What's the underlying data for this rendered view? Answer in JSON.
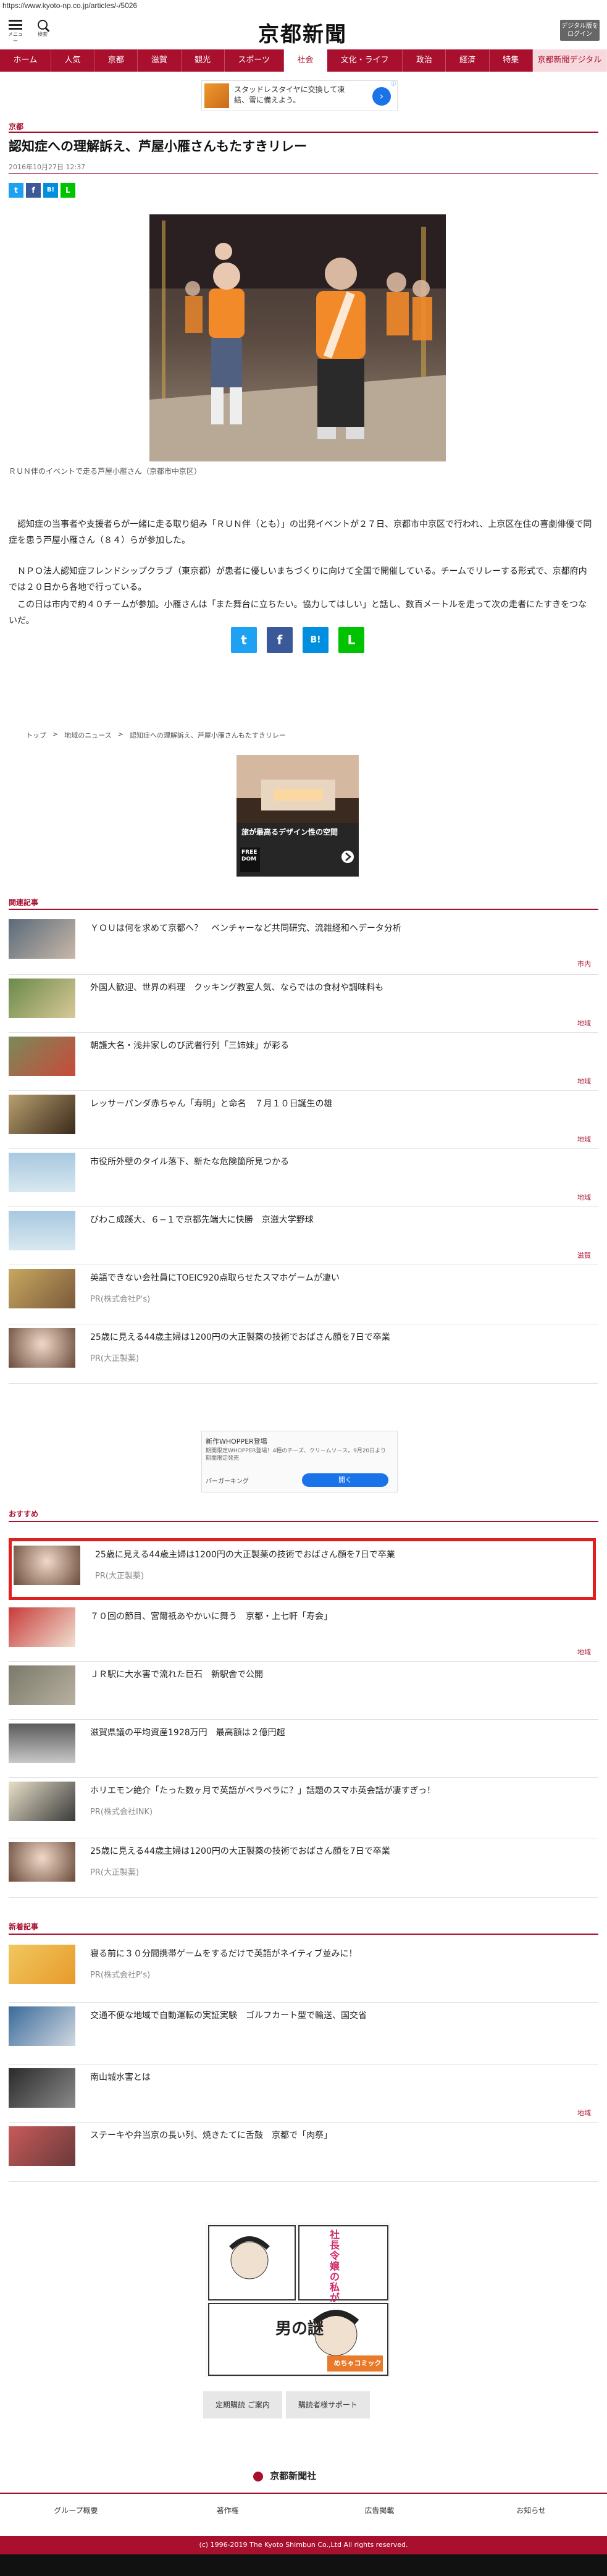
{
  "url": "https://www.kyoto-np.co.jp/articles/-/5026",
  "header": {
    "menu_label": "メニュー",
    "search_label": "検索",
    "logo": "京都新聞",
    "digital_label": "デジタル版をログイン"
  },
  "nav": [
    "ホーム",
    "人気",
    "京都",
    "滋賀",
    "観光",
    "スポーツ",
    "社会",
    "文化・ライフ",
    "政治",
    "経済",
    "特集",
    "京都新聞デジタル"
  ],
  "top_ad": {
    "text": "スタッドレスタイヤに交換して凍結、雪に備えよう。"
  },
  "article": {
    "category": "京都",
    "title": "認知症への理解訴え、芦屋小雁さんもたすきリレー",
    "date": "2016年10月27日 12:37",
    "caption": "ＲＵＮ伴のイベントで走る芦屋小雁さん（京都市中京区）",
    "paragraphs": [
      "　認知症の当事者や支援者らが一緒に走る取り組み「ＲＵＮ伴（とも）」の出発イベントが２７日、京都市中京区で行われ、上京区在住の喜劇俳優で同症を患う芦屋小雁さん（８４）らが参加した。",
      "　ＮＰＯ法人認知症フレンドシップクラブ（東京都）が患者に優しいまちづくりに向けて全国で開催している。チームでリレーする形式で、京都府内では２０日から各地で行っている。",
      "　この日は市内で約４０チームが参加。小雁さんは「また舞台に立ちたい。協力してはしい」と話し、数百メートルを走って次の走者にたすきをつないだ。"
    ]
  },
  "share": {
    "twitter": "t",
    "facebook": "f",
    "hatena": "B!",
    "line": "L"
  },
  "breadcrumb": [
    "トップ",
    "地域のニュース",
    "認知症への理解訴え、芦屋小雁さんもたすきリレー"
  ],
  "mid_ad": {
    "headline": "旅が最高るデザイン性の空間",
    "sub": "FREE DOM"
  },
  "related": {
    "label": "関連記事",
    "items": [
      {
        "title": "ＹＯＵは何を求めて京都へ？　ベンチャーなど共同研究、流雑経和ヘデータ分析",
        "tag": "市内"
      },
      {
        "title": "外国人歓迎、世界の料理　クッキング教室人気、ならではの食材や調味料も",
        "tag": "地域"
      },
      {
        "title": "朝護大名・浅井家しのび武者行列「三姉妹」が彩る",
        "tag": "地域"
      },
      {
        "title": "レッサーパンダ赤ちゃん「寿明」と命名　７月１０日誕生の雄",
        "tag": "地域"
      },
      {
        "title": "市役所外壁のタイル落下、新たな危険箇所見つかる",
        "tag": "地域"
      },
      {
        "title": "びわこ成蹊大、６−１で京都先端大に快勝　京滋大学野球",
        "tag": "滋賀"
      },
      {
        "title": "英語できない会社員にTOEIC920点取らせたスマホゲームが凄い",
        "pr": "PR(株式会社P's)"
      },
      {
        "title": "25歳に見える44歳主婦は1200円の大正製薬の技術でおばさん顔を7日で卒業",
        "pr": "PR(大正製薬)"
      }
    ]
  },
  "small_ad": {
    "line1": "新作WHOPPER登場",
    "line2": "期間限定WHOPPER登場！4種のチーズ、クリームソース。9月20日より期間限定発売",
    "line3": "バーガーキング",
    "cta": "開く"
  },
  "recommend": {
    "label": "おすすめ",
    "items": [
      {
        "title": "25歳に見える44歳主婦は1200円の大正製薬の技術でおばさん顔を7日で卒業",
        "pr": "PR(大正製薬)"
      },
      {
        "title": "７０回の節目、宮爾祇あやかいに舞う　京都・上七軒「寿会」",
        "tag": "地域"
      },
      {
        "title": "ＪＲ駅に大水害で流れた巨石　新駅舎で公開",
        "tag": ""
      },
      {
        "title": "滋賀県議の平均資産1928万円　最高額は２億円超",
        "tag": ""
      },
      {
        "title": "ホリエモン絶介「たった数ヶ月で英語がペラペラに？」話題のスマホ英会話が凄すぎっ！",
        "pr": "PR(株式会社INK)"
      },
      {
        "title": "25歳に見える44歳主婦は1200円の大正製薬の技術でおばさん顔を7日で卒業",
        "pr": "PR(大正製薬)"
      }
    ]
  },
  "latest": {
    "label": "新着記事",
    "items": [
      {
        "title": "寝る前に３０分間携帯ゲームをするだけで英語がネイティブ並みに！",
        "pr": "PR(株式会社P's)"
      },
      {
        "title": "交通不便な地域で自動運転の実証実験　ゴルフカート型で輸送、国交省",
        "tag": ""
      },
      {
        "title": "南山城水害とは",
        "tag": "地域"
      },
      {
        "title": "ステーキや弁当京の長い列、焼きたてに舌鼓　京都で「肉祭」",
        "tag": ""
      }
    ]
  },
  "bottom_ad": {
    "text1": "社長令嬢の私が",
    "text2": "男の謎",
    "brand": "めちゃコミック"
  },
  "footer": {
    "links": [
      "定期購読 ご案内",
      "購読者様サポート"
    ],
    "logo": "京都新聞社",
    "nav": [
      "グループ概要",
      "著作権",
      "広告掲載",
      "お知らせ"
    ],
    "copyright": "(c) 1996-2019 The Kyoto Shimbun Co.,Ltd All rights reserved."
  }
}
